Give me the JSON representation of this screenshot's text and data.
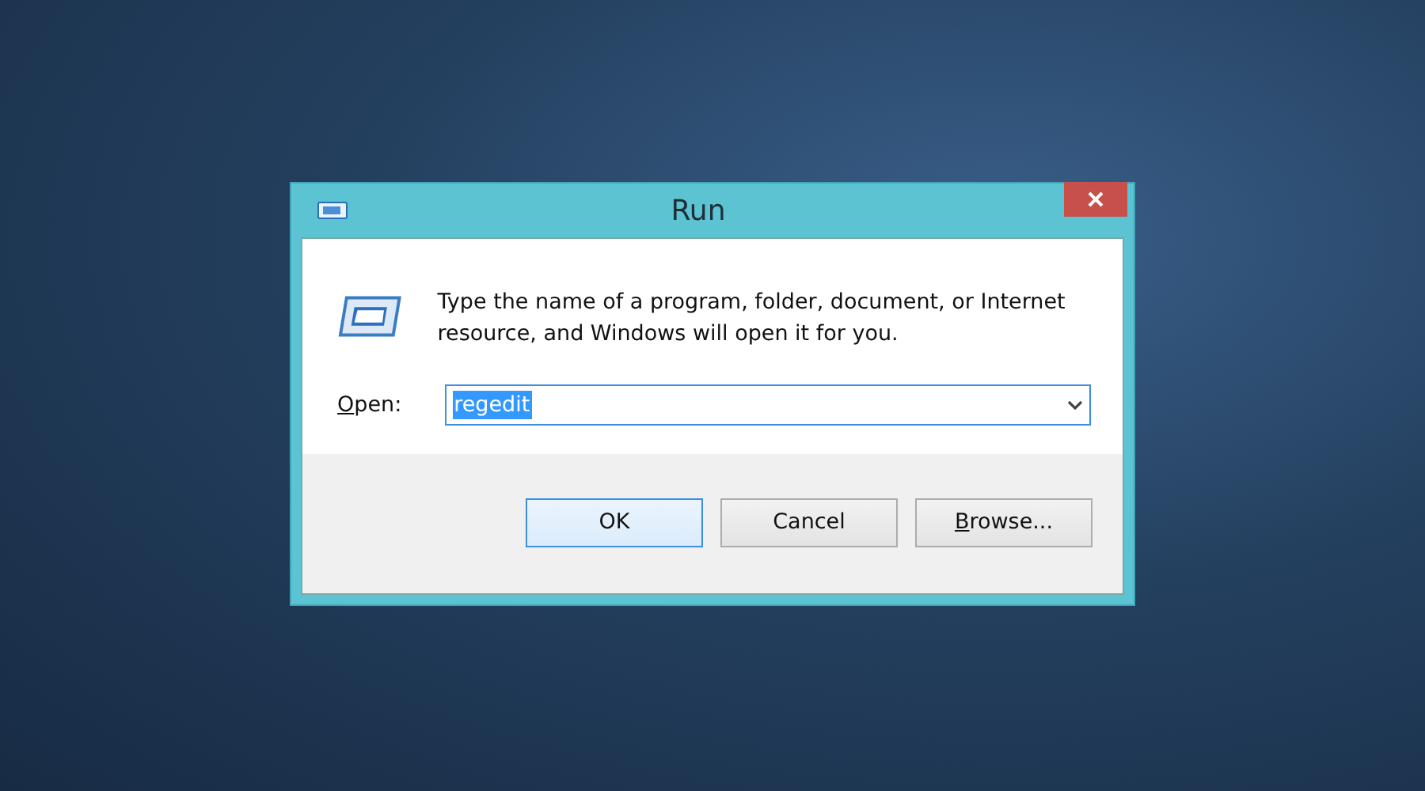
{
  "window": {
    "title": "Run"
  },
  "message": "Type the name of a program, folder, document, or Internet resource, and Windows will open it for you.",
  "open_field": {
    "label": "Open:",
    "label_underline_first": true,
    "value": "regedit",
    "text_selected": true
  },
  "buttons": [
    {
      "label": "OK",
      "default": true,
      "underline_first": false
    },
    {
      "label": "Cancel",
      "default": false,
      "underline_first": false
    },
    {
      "label": "Browse...",
      "default": false,
      "underline_first": true
    }
  ]
}
